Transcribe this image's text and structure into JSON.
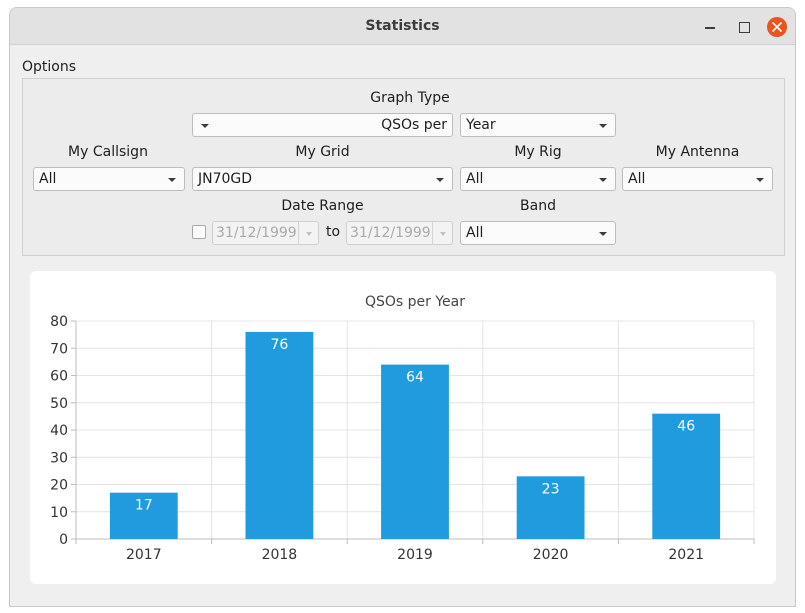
{
  "window": {
    "title": "Statistics"
  },
  "options": {
    "label": "Options",
    "graph_type": {
      "label": "Graph Type",
      "primary": "QSOs per",
      "secondary": "Year"
    },
    "my_callsign": {
      "label": "My Callsign",
      "value": "All"
    },
    "my_grid": {
      "label": "My Grid",
      "value": "JN70GD"
    },
    "my_rig": {
      "label": "My Rig",
      "value": "All"
    },
    "my_antenna": {
      "label": "My Antenna",
      "value": "All"
    },
    "date_range": {
      "label": "Date Range",
      "from": "31/12/1999",
      "to_label": "to",
      "to": "31/12/1999",
      "enabled": false
    },
    "band": {
      "label": "Band",
      "value": "All"
    }
  },
  "colors": {
    "bar": "#1f9bde",
    "close_button": "#e95420"
  },
  "chart_data": {
    "type": "bar",
    "title": "QSOs per Year",
    "categories": [
      "2017",
      "2018",
      "2019",
      "2020",
      "2021"
    ],
    "values": [
      17,
      76,
      64,
      23,
      46
    ],
    "ylim": [
      0,
      80
    ],
    "yticks": [
      0,
      10,
      20,
      30,
      40,
      50,
      60,
      70,
      80
    ],
    "grid": true,
    "data_labels": true
  }
}
